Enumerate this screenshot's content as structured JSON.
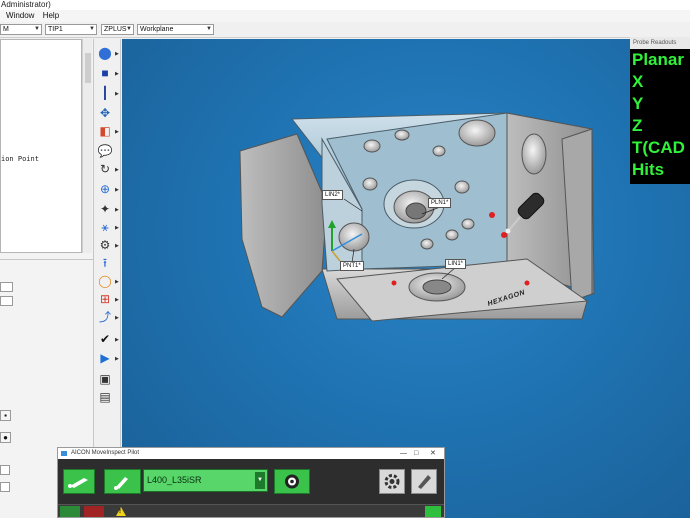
{
  "window": {
    "title": "Administrator)"
  },
  "menu": {
    "items": [
      "Window",
      "Help"
    ]
  },
  "toolbar": {
    "combos": [
      {
        "value": "M"
      },
      {
        "value": "TIP1"
      },
      {
        "value": "ZPLUS"
      },
      {
        "value": "Workplane"
      }
    ]
  },
  "edit_window": {
    "lines": [
      "ion Point"
    ]
  },
  "viewport": {
    "labels": {
      "lin2": "LIN2*",
      "pln1": "PLN1*",
      "pnt1": "PNT1*",
      "lin1": "LIN1*"
    },
    "logo_text": "HEXAGON",
    "background_color": "#1f73b2"
  },
  "readouts": {
    "header": "Probe Readouts",
    "lines": [
      "Planar",
      "X",
      "Y",
      "Z",
      "T(CAD",
      "Hits"
    ],
    "color": "#31f23a"
  },
  "pilot": {
    "title": "AICON MoveInspect Pilot",
    "controls": [
      "—",
      "□",
      "✕"
    ],
    "probe": "L400_L35iSR"
  }
}
